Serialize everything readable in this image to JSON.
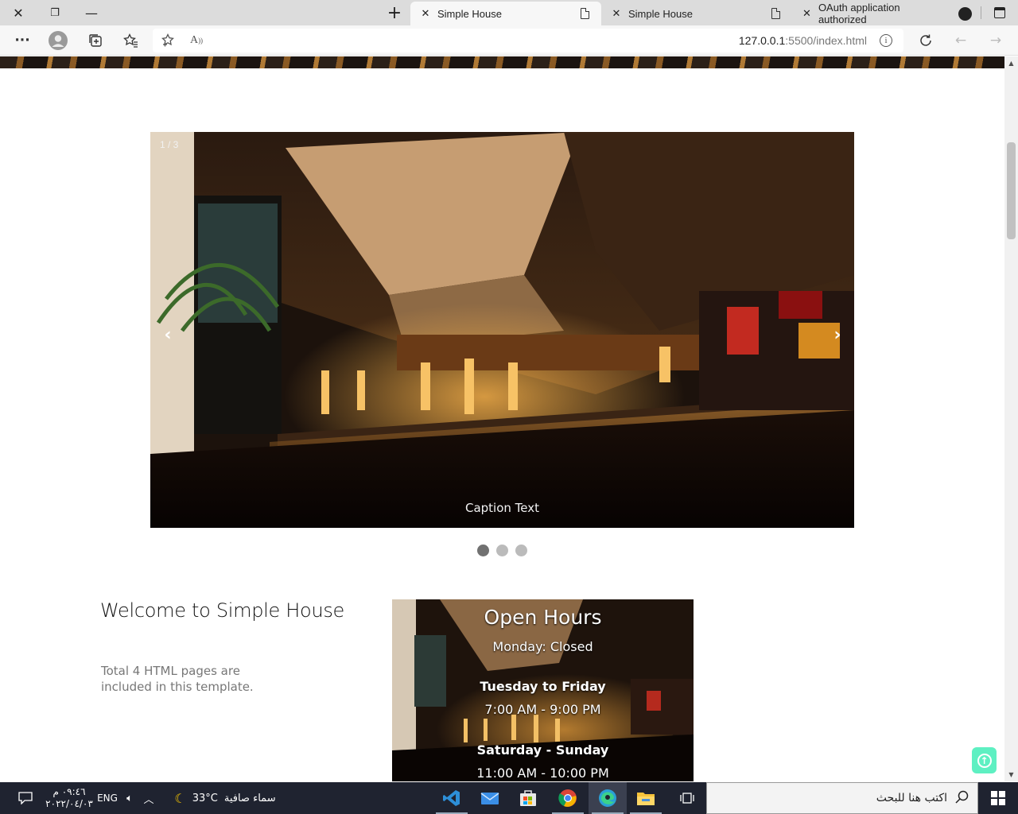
{
  "browser": {
    "window_controls": {
      "close": "✕",
      "restore": "❐",
      "minimize": "—"
    },
    "new_tab": "+",
    "tabs": [
      {
        "title": "Simple House",
        "active": true
      },
      {
        "title": "Simple House",
        "active": false
      },
      {
        "title": "OAuth application authorized",
        "active": false
      }
    ],
    "address": {
      "url_host": "127.0.0.1",
      "url_rest": ":5500/index.html"
    }
  },
  "page": {
    "slideshow": {
      "counter": "1 / 3",
      "caption": "Caption Text",
      "prev": "‹",
      "next": "›",
      "dots": 3,
      "active_dot": 1
    },
    "welcome": {
      "title": "Welcome to Simple House",
      "text": "Total 4 HTML pages are included in this template."
    },
    "hours": {
      "title": "Open Hours",
      "monday": "Monday: Closed",
      "weekday_label": "Tuesday to Friday",
      "weekday_time": "7:00 AM - 9:00 PM",
      "weekend_label": "Saturday - Sunday",
      "weekend_time": "11:00 AM - 10:00 PM"
    }
  },
  "taskbar": {
    "search_placeholder": "اكتب هنا للبحث",
    "weather": {
      "temp": "33°C",
      "condition": "سماء صافية"
    },
    "language": "ENG",
    "time": "٠٩:٤٦ م",
    "date": "٢٠٢٢/٠٤/٠٣"
  },
  "colors": {
    "accent_totop": "#5ef0c2",
    "taskbar": "#1f2330",
    "dot_active": "#717171",
    "dot": "#bbbbbb"
  }
}
